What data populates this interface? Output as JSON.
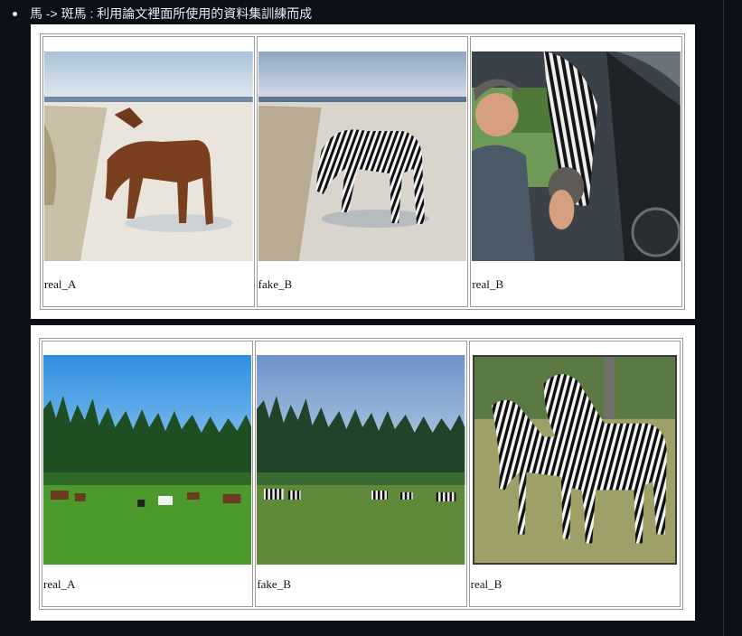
{
  "bullet": {
    "text": "馬 -> 斑馬 : 利用論文裡面所使用的資料集訓練而成"
  },
  "rows": [
    {
      "cells": [
        {
          "caption": "real_A",
          "image_icon": "horse-beach-photo"
        },
        {
          "caption": "fake_B",
          "image_icon": "zebra-beach-photo"
        },
        {
          "caption": "real_B",
          "image_icon": "man-zebra-car-photo"
        }
      ]
    },
    {
      "cells": [
        {
          "caption": "real_A",
          "image_icon": "horses-meadow-photo"
        },
        {
          "caption": "fake_B",
          "image_icon": "zebras-meadow-photo"
        },
        {
          "caption": "real_B",
          "image_icon": "two-zebras-photo"
        }
      ]
    }
  ]
}
